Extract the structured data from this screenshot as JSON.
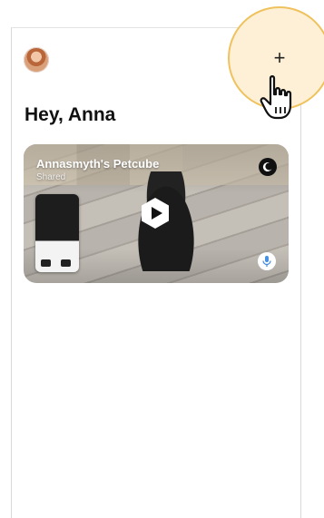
{
  "header": {
    "add_symbol": "+"
  },
  "greeting": "Hey, Anna",
  "camera_card": {
    "title": "Annasmyth's Petcube",
    "subtitle": "Shared",
    "device_brand": "Petcube"
  },
  "icons": {
    "avatar": "avatar",
    "add": "plus-icon",
    "night_mode": "moon-icon",
    "play": "play-icon",
    "mic": "microphone-icon",
    "cursor": "hand-pointer-icon"
  },
  "colors": {
    "highlight_fill": "#fdf0d6",
    "highlight_ring": "#efc25e",
    "mic_accent": "#4a90e2"
  }
}
